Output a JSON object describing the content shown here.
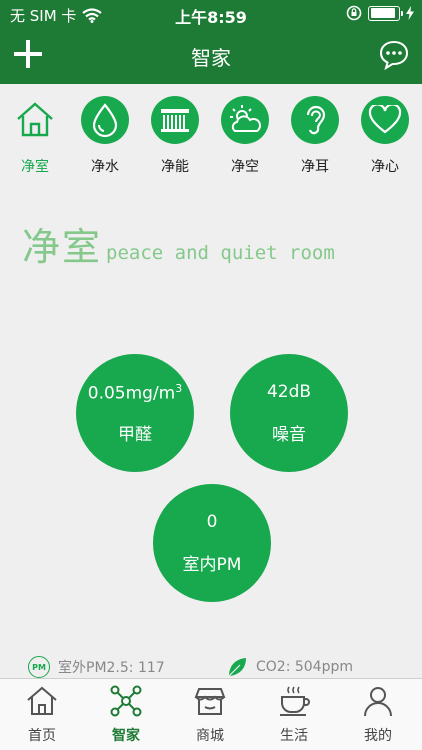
{
  "status_bar": {
    "carrier": "无 SIM 卡",
    "time": "上午8:59",
    "battery_level": 0.9
  },
  "nav": {
    "title": "智家",
    "left_icon": "plus-icon",
    "right_icon": "chat-bubble-icon"
  },
  "categories": [
    {
      "label": "净室",
      "icon": "house-icon",
      "active": true
    },
    {
      "label": "净水",
      "icon": "water-drop-icon",
      "active": false
    },
    {
      "label": "净能",
      "icon": "solar-panel-icon",
      "active": false
    },
    {
      "label": "净空",
      "icon": "sun-cloud-icon",
      "active": false
    },
    {
      "label": "净耳",
      "icon": "ear-icon",
      "active": false
    },
    {
      "label": "净心",
      "icon": "heart-icon",
      "active": false
    }
  ],
  "heading": {
    "cn": "净室",
    "en": "peace and quiet room"
  },
  "metrics": {
    "formaldehyde": {
      "value": "0.05mg/m",
      "unit_sup": "3",
      "label": "甲醛"
    },
    "noise": {
      "value": "42dB",
      "label": "噪音"
    },
    "indoor_pm": {
      "value": "0",
      "label": "室内PM"
    }
  },
  "stats": {
    "pm_icon_text": "PM",
    "outdoor_pm": "室外PM2.5: 117",
    "co2": "CO2: 504ppm"
  },
  "tabs": [
    {
      "label": "首页",
      "icon": "home-icon",
      "active": false
    },
    {
      "label": "智家",
      "icon": "network-icon",
      "active": true
    },
    {
      "label": "商城",
      "icon": "store-icon",
      "active": false
    },
    {
      "label": "生活",
      "icon": "coffee-cup-icon",
      "active": false
    },
    {
      "label": "我的",
      "icon": "user-icon",
      "active": false
    }
  ],
  "colors": {
    "header": "#1e7b36",
    "accent": "#18a84e",
    "heading_text": "#84c98b",
    "background": "#efefef"
  }
}
